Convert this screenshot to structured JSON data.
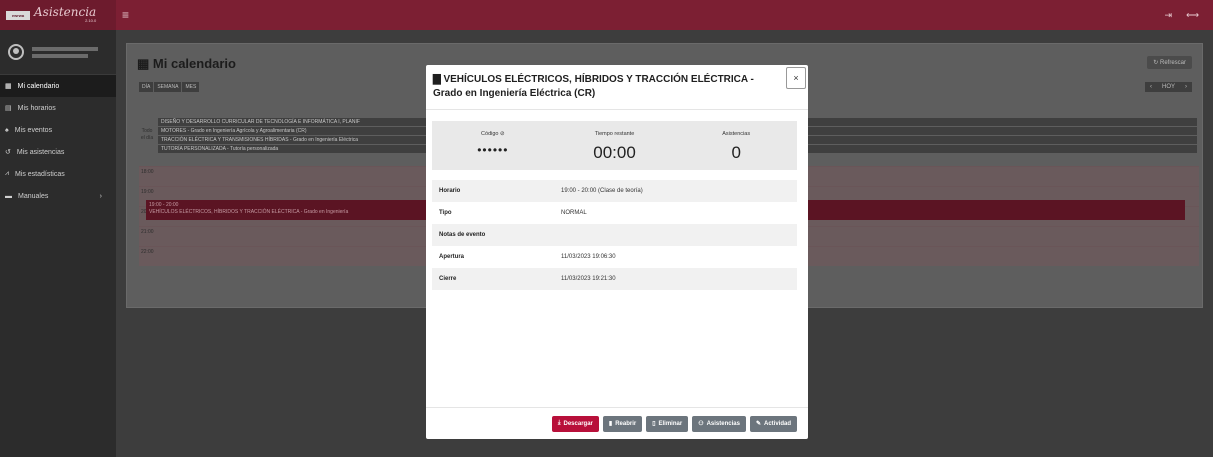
{
  "brand": {
    "logo": "ewrwa",
    "name": "Asistencia",
    "version": "2.10.0"
  },
  "sidebar": {
    "items": [
      {
        "label": "Mi calendario",
        "icon": "calendar-icon",
        "active": true
      },
      {
        "label": "Mis horarios",
        "icon": "schedule-icon"
      },
      {
        "label": "Mis eventos",
        "icon": "bell-icon"
      },
      {
        "label": "Mis asistencias",
        "icon": "history-icon"
      },
      {
        "label": "Mis estadísticas",
        "icon": "chart-icon"
      },
      {
        "label": "Manuales",
        "icon": "book-icon",
        "arrow": "›"
      }
    ]
  },
  "calendar": {
    "title": "Mi calendario",
    "refresh_label": "Refrescar",
    "views": [
      "DÍA",
      "SEMANA",
      "MES"
    ],
    "nav": {
      "prev": "‹",
      "today": "HOY",
      "next": "›"
    },
    "allday_label": "Todo el día",
    "allday_events": [
      "DISEÑO Y DESARROLLO CURRICULAR DE TECNOLOGÍA E INFORMÁTICA I, PLANIF",
      "MOTORES - Grado en Ingeniería Agrícola y Agroalimentaria (CR)",
      "TRACCIÓN ELÉCTRICA Y TRANSMISIONES HÍBRIDAS - Grado en Ingeniería Eléctrica",
      "TUTORÍA PERSONALIZADA - Tutoría personalizada"
    ],
    "hours": [
      "18:00",
      "19:00",
      "20:00",
      "21:00",
      "22:00"
    ],
    "slot_event": {
      "time": "19:00 - 20:00",
      "title": "VEHÍCULOS ELÉCTRICOS, HÍBRIDOS Y TRACCIÓN ELÉCTRICA - Grado en Ingeniería"
    }
  },
  "modal": {
    "title": "VEHÍCULOS ELÉCTRICOS, HÍBRIDOS Y TRACCIÓN ELÉCTRICA - Grado en Ingeniería Eléctrica (CR)",
    "close": "×",
    "stats": {
      "code_label": "Código",
      "code_value": "••••••",
      "remaining_label": "Tiempo restante",
      "remaining_value": "00:00",
      "attendance_label": "Asistencias",
      "attendance_value": "0"
    },
    "rows": [
      {
        "key": "Horario",
        "value": "19:00 - 20:00 (Clase de teoría)"
      },
      {
        "key": "Tipo",
        "value": "NORMAL"
      },
      {
        "key": "Notas de evento",
        "value": ""
      },
      {
        "key": "Apertura",
        "value": "11/03/2023 19:06:30"
      },
      {
        "key": "Cierre",
        "value": "11/03/2023 19:21:30"
      }
    ],
    "buttons": {
      "download": "Descargar",
      "reopen": "Reabrir",
      "delete": "Eliminar",
      "attendances": "Asistencias",
      "activity": "Actividad"
    }
  },
  "colors": {
    "topbar": "#7c1f33",
    "primary_button": "#b8103a",
    "secondary_button": "#6c757d"
  }
}
